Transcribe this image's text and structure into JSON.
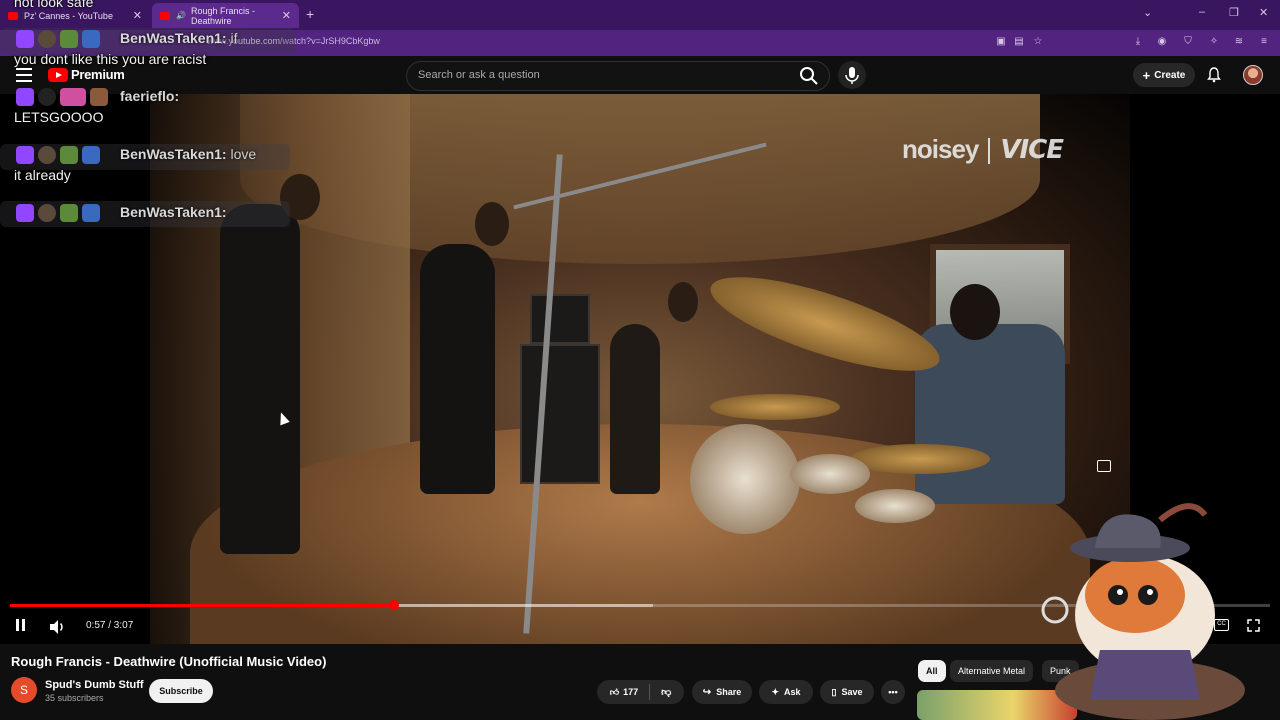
{
  "browser": {
    "tabs": [
      {
        "title": "Pz' Cannes - YouTube",
        "active": false
      },
      {
        "title": "Rough Francis - Deathwire",
        "active": true
      }
    ],
    "url_prefix": "www.",
    "url_domain": "youtube.com",
    "url_path": "/watch?v=JrSH9CbKgbw"
  },
  "youtube": {
    "logo_text": "Premium",
    "search_placeholder": "Search or ask a question",
    "create_label": "Create"
  },
  "video": {
    "watermark_left": "noisey",
    "watermark_right": "VICE",
    "current_time": "0:57",
    "duration": "3:07",
    "time_display": "0:57 / 3:07",
    "progress_fraction": 0.305,
    "buffer_fraction": 0.51
  },
  "meta": {
    "title": "Rough Francis - Deathwire (Unofficial Music Video)",
    "channel": "Spud's Dumb Stuff",
    "channel_initial": "S",
    "subscribers": "35 subscribers",
    "subscribe_label": "Subscribe",
    "likes": "177",
    "share_label": "Share",
    "ask_label": "Ask",
    "save_label": "Save"
  },
  "chips": [
    "All",
    "Alternative Metal",
    "Punk"
  ],
  "chat": {
    "top_fragment": "not look safe",
    "messages": [
      {
        "user": "BenWasTaken1:",
        "text_inline": "if",
        "text": "you dont like this you are racist"
      },
      {
        "user": "faerieflo:",
        "text_inline": "",
        "text": "LETSGOOOO"
      },
      {
        "user": "BenWasTaken1:",
        "text_inline": "love",
        "text": "it already"
      },
      {
        "user": "BenWasTaken1:",
        "text_inline": "",
        "text": ""
      }
    ]
  },
  "colors": {
    "tabbar": "#3a1560",
    "addressbar": "#52237f",
    "accent_red": "#ff0000",
    "page_bg": "#0f0f0f"
  }
}
